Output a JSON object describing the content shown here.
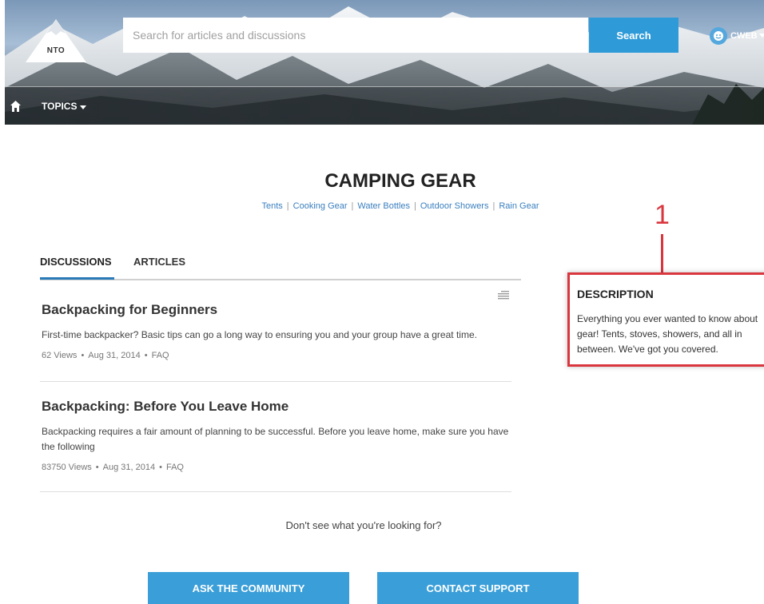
{
  "header": {
    "logo_text": "NTO",
    "search": {
      "placeholder": "Search for articles and discussions",
      "button_label": "Search"
    },
    "user": {
      "name": "CWEB"
    },
    "nav": {
      "topics_label": "TOPICS"
    }
  },
  "page": {
    "title": "CAMPING GEAR",
    "subtopics": [
      "Tents",
      "Cooking Gear",
      "Water Bottles",
      "Outdoor Showers",
      "Rain Gear"
    ]
  },
  "tabs": [
    {
      "label": "DISCUSSIONS",
      "active": true
    },
    {
      "label": "ARTICLES",
      "active": false
    }
  ],
  "feed": [
    {
      "title": "Backpacking for Beginners",
      "body": "First-time backpacker? Basic tips can go a long way to ensuring you and your group have a great time.",
      "views": "62 Views",
      "date": "Aug 31, 2014",
      "type": "FAQ"
    },
    {
      "title": "Backpacking: Before You Leave Home",
      "body": "Backpacking requires a fair amount of planning to be successful. Before you leave home, make sure you have the following",
      "views": "83750 Views",
      "date": "Aug 31, 2014",
      "type": "FAQ"
    }
  ],
  "footer": {
    "not_found_text": "Don't see what you're looking for?",
    "ask_label": "ASK THE COMMUNITY",
    "support_label": "CONTACT SUPPORT"
  },
  "description": {
    "callout_number": "1",
    "title": "DESCRIPTION",
    "text": "Everything you ever wanted to know about gear! Tents, stoves, showers, and all in between. We've got you covered."
  },
  "colors": {
    "accent": "#2e9bd8",
    "link": "#3a7fbf",
    "callout": "#d9363e"
  },
  "icons": [
    "nto-logo-mountain-icon",
    "user-avatar-icon",
    "chevron-down-icon",
    "home-icon",
    "caret-down-icon",
    "filter-sort-icon"
  ]
}
